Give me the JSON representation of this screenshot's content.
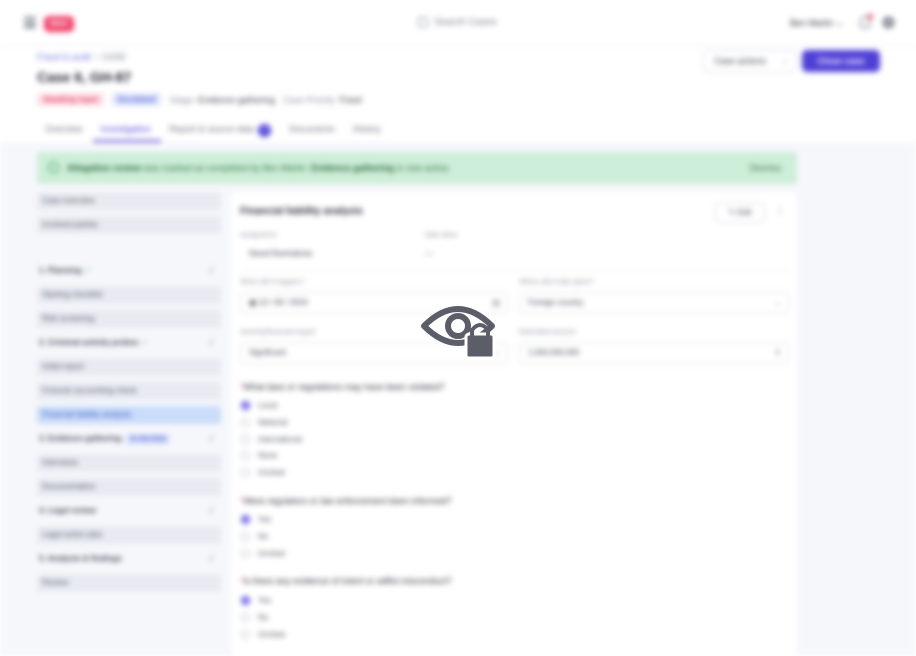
{
  "topbar": {
    "logo_text": "MAX",
    "search_placeholder": "Search Cases",
    "user_name": "Ben Martin"
  },
  "header": {
    "breadcrumb": [
      "Fraud & audit",
      "CASE"
    ],
    "title": "Case 6, GH-87",
    "badges": [
      "Awaiting input",
      "Escalated"
    ],
    "meta": [
      {
        "key": "Stage:",
        "value": "Evidence gathering"
      },
      {
        "key": "Case Priority:",
        "value": "Fixed"
      }
    ],
    "actions_label": "Case actions",
    "primary_label": "Close case"
  },
  "tabs": [
    {
      "label": "Overview"
    },
    {
      "label": "Investigation"
    },
    {
      "label": "Report & source data",
      "count": "4"
    },
    {
      "label": "Documents"
    },
    {
      "label": "History"
    }
  ],
  "banner": {
    "lead": "Allegation review",
    "text": "was marked as completed by Ben Martin.",
    "link": "Evidence gathering",
    "suffix": "is now active.",
    "dismiss": "Dismiss"
  },
  "sidebar": {
    "top_items": [
      "Case overview",
      "Involved parties"
    ],
    "sections": [
      {
        "label": "1. Planning",
        "done": true,
        "items": [
          "Starting checklist",
          "Risk screening"
        ]
      },
      {
        "label": "2. Criminal activity probes",
        "done": true,
        "items": [
          "Initial report",
          "Forensic accounting check",
          "Financial liability analysis"
        ]
      },
      {
        "label": "3. Evidence gathering",
        "status": "IN REVIEW",
        "items": [
          "Interviews",
          "Documentation"
        ]
      },
      {
        "label": "4. Legal review",
        "done": false,
        "items": [
          "Legal action plan"
        ]
      },
      {
        "label": "5. Analysis & findings",
        "done": false,
        "items": [
          "Review"
        ]
      }
    ]
  },
  "panel": {
    "title": "Financial liability analysis",
    "edit_label": "Edit",
    "assigned_label": "Assigned to",
    "assigned_value": "Naval Ravinderan",
    "date_label": "Date done",
    "date_value": "—",
    "when_label": "When did it happen?",
    "when_value": "10 / 06 / 2024",
    "where_label": "Where did it take place?",
    "where_value": "Foreign country",
    "impact_label": "Severity/financial impact",
    "impact_value": "Significant",
    "amount_label": "Estimated amount",
    "amount_value": "1,000,000,000",
    "questions": [
      {
        "text": "What laws or regulations may have been violated?",
        "options": [
          "Local",
          "National",
          "International",
          "None",
          "Unclear"
        ],
        "selected": 0
      },
      {
        "text": "Were regulators or law enforcement been informed?",
        "options": [
          "Yes",
          "No",
          "Unclear"
        ],
        "selected": 0
      },
      {
        "text": "Is there any evidence of intent or willful misconduct?",
        "options": [
          "Yes",
          "No",
          "Unclear"
        ],
        "selected": 0
      }
    ]
  },
  "colors": {
    "accent": "#4f3fd6",
    "banner": "#cdeed8",
    "danger": "#f0406a"
  },
  "icons": [
    "menu-icon",
    "search-icon",
    "bell-icon",
    "gear-icon",
    "eye-lock-icon"
  ]
}
